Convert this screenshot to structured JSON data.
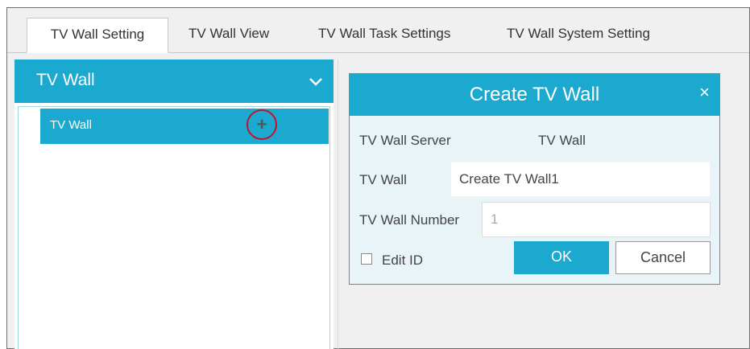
{
  "tabs": [
    {
      "label": "TV Wall Setting",
      "active": true
    },
    {
      "label": "TV Wall View"
    },
    {
      "label": "TV Wall Task Settings"
    },
    {
      "label": "TV Wall System Setting"
    }
  ],
  "left_panel": {
    "title": "TV Wall",
    "tree_items": [
      {
        "label": "TV Wall",
        "add_glyph": "+"
      }
    ]
  },
  "dialog": {
    "title": "Create TV Wall",
    "close_glyph": "×",
    "server_label": "TV Wall Server",
    "server_value": "TV Wall",
    "name_label": "TV Wall",
    "name_value": "Create TV Wall1",
    "number_label": "TV Wall Number",
    "number_placeholder": "1",
    "edit_id_label": "Edit ID",
    "ok_label": "OK",
    "cancel_label": "Cancel"
  },
  "colors": {
    "accent": "#1ba9cf",
    "highlight_circle": "#c8102e"
  },
  "icons": {
    "collapse": "chevron-down-icon",
    "add": "plus-icon",
    "close": "close-icon"
  }
}
